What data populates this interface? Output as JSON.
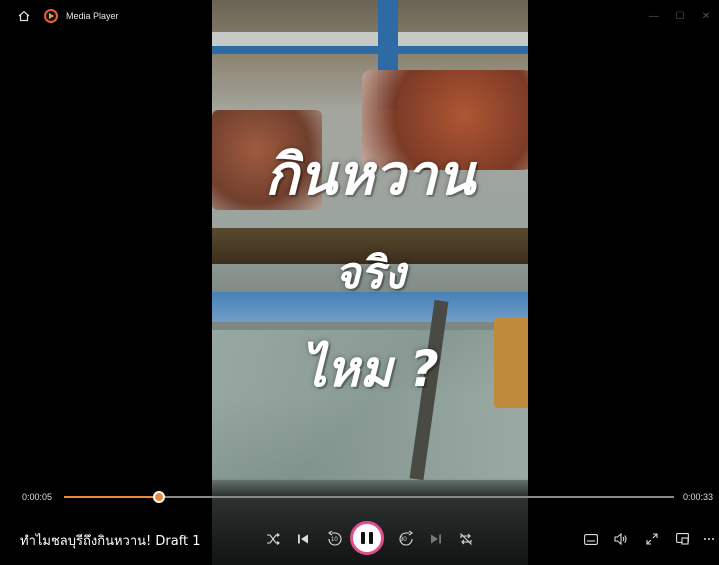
{
  "window": {
    "title": "Media Player",
    "controls": [
      "minimize",
      "maximize",
      "close"
    ]
  },
  "video": {
    "overlay_lines": [
      "กินหวาน",
      "จริง",
      "ไหม ?"
    ]
  },
  "playback": {
    "current_time": "0:00:05",
    "duration": "0:00:33",
    "progress_fraction": 0.156
  },
  "now_playing": {
    "title": "ทำไมชลบุรีถึงกินหวาน! Draft 1"
  },
  "controls": {
    "skip_back_label": "10",
    "skip_forward_label": "30",
    "accent_color": "#e8893e",
    "play_ring_color": "#e04f8c"
  },
  "icons": [
    "home-icon",
    "app-icon",
    "shuffle-icon",
    "previous-icon",
    "skip-back-icon",
    "pause-icon",
    "skip-forward-icon",
    "next-icon",
    "repeat-off-icon",
    "subtitles-icon",
    "volume-icon",
    "fullscreen-icon",
    "miniplayer-icon",
    "more-icon"
  ]
}
